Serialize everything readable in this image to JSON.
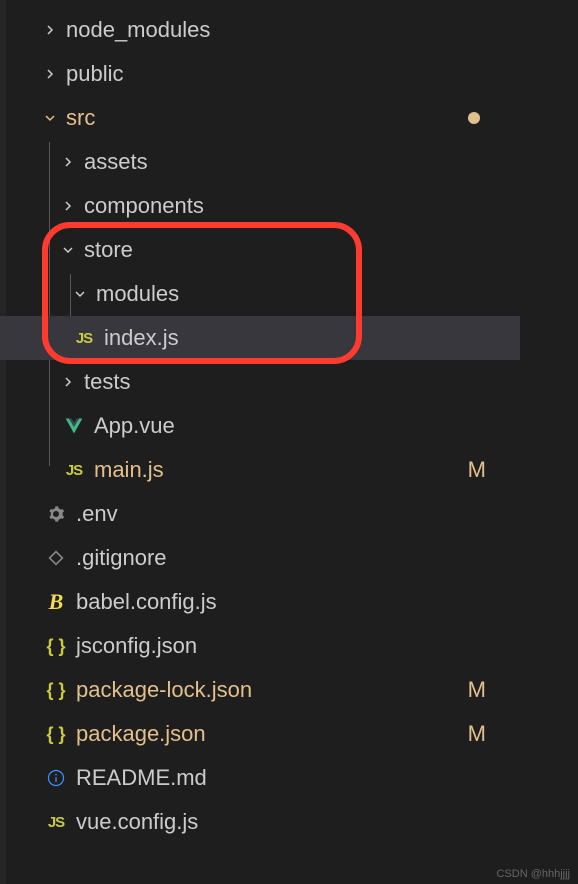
{
  "tree": {
    "node_modules": {
      "label": "node_modules"
    },
    "public": {
      "label": "public"
    },
    "src": {
      "label": "src",
      "status": "modified"
    },
    "assets": {
      "label": "assets"
    },
    "components": {
      "label": "components"
    },
    "store": {
      "label": "store"
    },
    "modules": {
      "label": "modules"
    },
    "index_js": {
      "label": "index.js"
    },
    "tests": {
      "label": "tests"
    },
    "app_vue": {
      "label": "App.vue"
    },
    "main_js": {
      "label": "main.js",
      "status_badge": "M"
    },
    "env": {
      "label": ".env"
    },
    "gitignore": {
      "label": ".gitignore"
    },
    "babel_config": {
      "label": "babel.config.js"
    },
    "jsconfig": {
      "label": "jsconfig.json"
    },
    "package_lock": {
      "label": "package-lock.json",
      "status_badge": "M"
    },
    "package": {
      "label": "package.json",
      "status_badge": "M"
    },
    "readme": {
      "label": "README.md"
    },
    "vue_config": {
      "label": "vue.config.js"
    }
  },
  "icons": {
    "js": "JS",
    "json": "{ }",
    "babel": "B"
  },
  "watermark": "CSDN @hhhjjjj"
}
